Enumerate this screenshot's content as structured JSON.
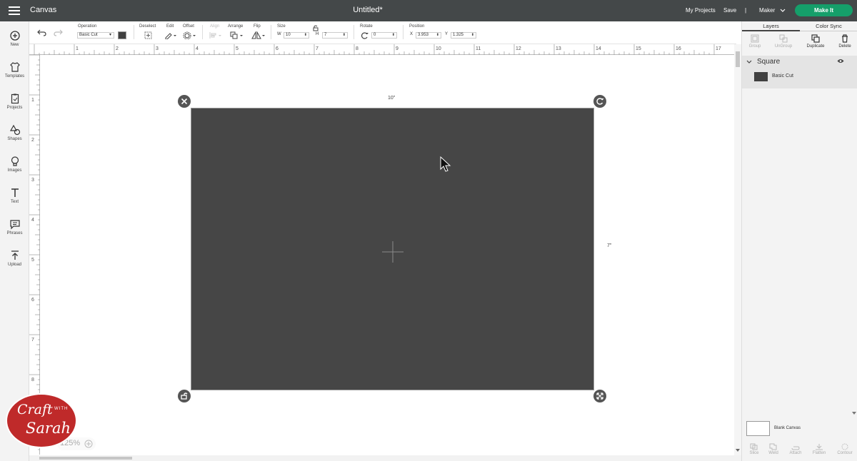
{
  "app": {
    "title": "Canvas",
    "document_title": "Untitled*"
  },
  "topbar": {
    "my_projects": "My Projects",
    "save": "Save",
    "divider": "|",
    "machine": "Maker",
    "make_it": "Make It"
  },
  "leftbar": {
    "items": [
      {
        "label": "New",
        "icon": "plus-circle-icon"
      },
      {
        "label": "Templates",
        "icon": "shirt-icon"
      },
      {
        "label": "Projects",
        "icon": "clipboard-icon"
      },
      {
        "label": "Shapes",
        "icon": "shapes-icon"
      },
      {
        "label": "Images",
        "icon": "lightbulb-icon"
      },
      {
        "label": "Text",
        "icon": "text-t-icon"
      },
      {
        "label": "Phrases",
        "icon": "speech-bubble-icon"
      },
      {
        "label": "Upload",
        "icon": "upload-arrow-icon"
      }
    ]
  },
  "toolbar": {
    "operation_label": "Operation",
    "operation_value": "Basic Cut",
    "deselect_label": "Deselect",
    "edit_label": "Edit",
    "offset_label": "Offset",
    "align_label": "Align",
    "arrange_label": "Arrange",
    "flip_label": "Flip",
    "size_label": "Size",
    "w_label": "W",
    "w_value": "10",
    "h_label": "H",
    "h_value": "7",
    "rotate_label": "Rotate",
    "rotate_value": "0",
    "position_label": "Position",
    "x_label": "X",
    "x_value": "3.953",
    "y_label": "Y",
    "y_value": "1.325"
  },
  "ruler": {
    "top_ticks": [
      "1",
      "2",
      "3",
      "4",
      "5",
      "6",
      "7",
      "8",
      "9",
      "10",
      "11",
      "12",
      "13",
      "14",
      "15",
      "16",
      "17"
    ],
    "left_ticks": [
      "1",
      "2",
      "3",
      "4",
      "5",
      "6",
      "7",
      "8"
    ]
  },
  "canvas": {
    "width_label": "10\"",
    "height_label": "7\"",
    "zoom": "125%"
  },
  "logo": {
    "text_line1": "Craft",
    "text_with": "WITH",
    "text_line2": "Sarah"
  },
  "right_panel": {
    "tabs": [
      "Layers",
      "Color Sync"
    ],
    "tools": [
      "Group",
      "UnGroup",
      "Duplicate",
      "Delete"
    ],
    "layer_group": "Square",
    "layer_item": "Basic Cut",
    "blank_canvas": "Blank Canvas",
    "bottom_tools": [
      "Slice",
      "Weld",
      "Attach",
      "Flatten",
      "Contour"
    ]
  },
  "colors": {
    "topbar": "#444849",
    "make_it": "#159f6a",
    "shape_fill": "#464646"
  }
}
